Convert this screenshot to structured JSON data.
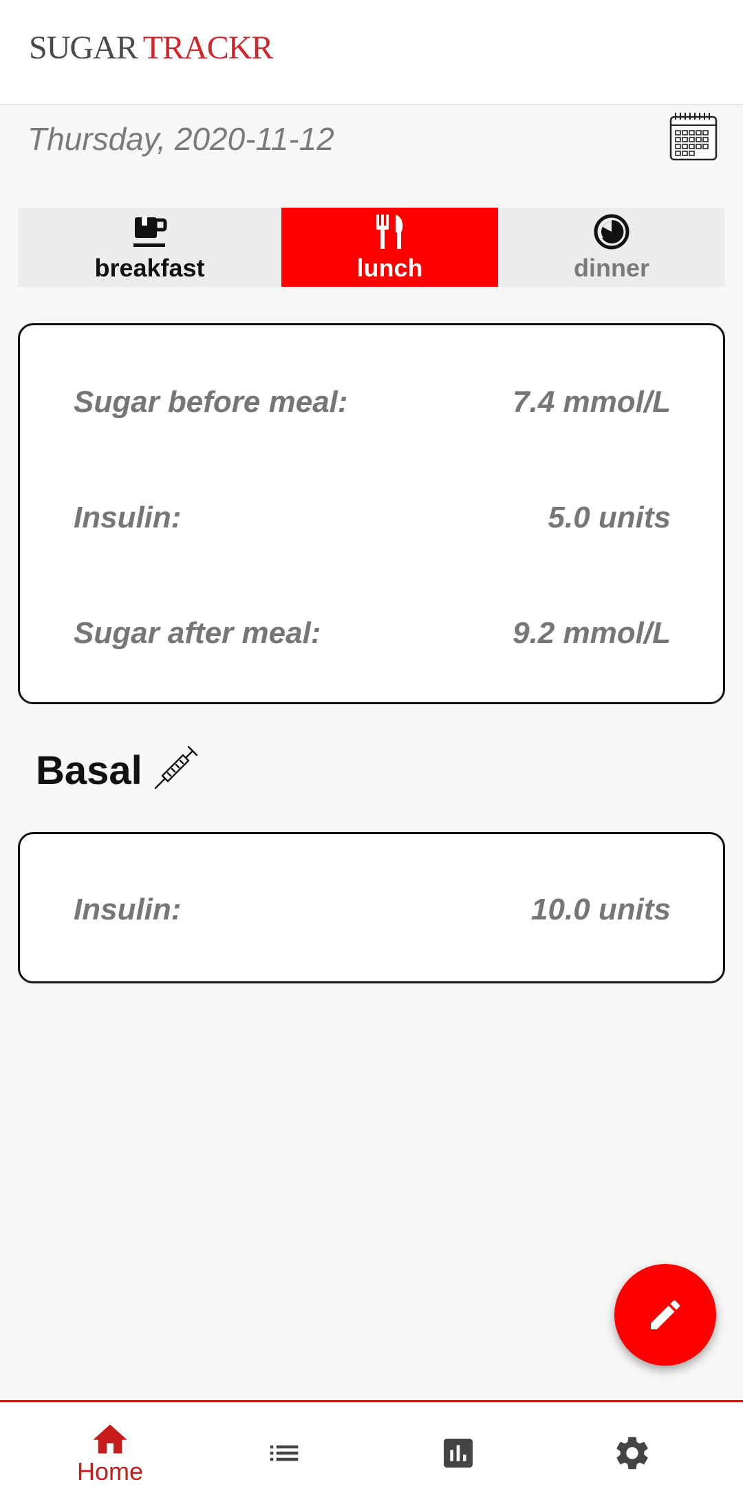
{
  "header": {
    "logo_part1": "SUGAR",
    "logo_part2": "TRACKR"
  },
  "date": {
    "text": "Thursday, 2020-11-12",
    "calendar_icon": "calendar-icon"
  },
  "meal_tabs": [
    {
      "label": "breakfast",
      "icon": "coffee-cup-icon",
      "selected": false
    },
    {
      "label": "lunch",
      "icon": "fork-knife-icon",
      "selected": true
    },
    {
      "label": "dinner",
      "icon": "half-moon-icon",
      "selected": false
    }
  ],
  "meal_card": {
    "rows": [
      {
        "label": "Sugar before meal:",
        "value": "7.4 mmol/L"
      },
      {
        "label": "Insulin:",
        "value": "5.0 units"
      },
      {
        "label": "Sugar after meal:",
        "value": "9.2 mmol/L"
      }
    ]
  },
  "basal": {
    "title": "Basal",
    "icon": "syringe-icon",
    "rows": [
      {
        "label": "Insulin:",
        "value": "10.0 units"
      }
    ]
  },
  "fab": {
    "icon": "edit-pencil-icon"
  },
  "bottom_nav": {
    "items": [
      {
        "label": "Home",
        "icon": "home-icon",
        "active": true
      },
      {
        "icon": "list-icon"
      },
      {
        "icon": "bar-chart-icon"
      },
      {
        "icon": "settings-gear-icon"
      }
    ]
  },
  "colors": {
    "accent": "#fe0000",
    "brand_red": "#d3242a",
    "nav_active": "#c61c1c"
  }
}
